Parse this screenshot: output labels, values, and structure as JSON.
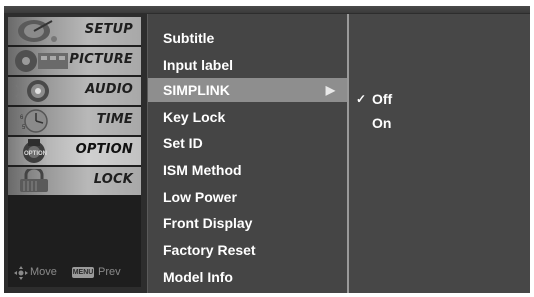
{
  "tabs": [
    {
      "label": "SETUP",
      "icon": "satellite-dish-icon",
      "active": false
    },
    {
      "label": "PICTURE",
      "icon": "film-reel-icon",
      "active": false
    },
    {
      "label": "AUDIO",
      "icon": "speaker-icon",
      "active": false
    },
    {
      "label": "TIME",
      "icon": "clock-icon",
      "active": false
    },
    {
      "label": "OPTION",
      "icon": "option-disc-icon",
      "active": true
    },
    {
      "label": "LOCK",
      "icon": "lock-icon",
      "active": false
    }
  ],
  "footer": {
    "move_icon": "directional-pad-icon",
    "move_label": "Move",
    "menu_key": "MENU",
    "prev_label": "Prev"
  },
  "menu": {
    "items": [
      {
        "label": "Subtitle"
      },
      {
        "label": "Input label"
      },
      {
        "label": "SIMPLINK",
        "selected": true,
        "has_submenu": true
      },
      {
        "label": "Key Lock"
      },
      {
        "label": "Set ID"
      },
      {
        "label": "ISM Method"
      },
      {
        "label": "Low Power"
      },
      {
        "label": "Front Display"
      },
      {
        "label": "Factory Reset"
      },
      {
        "label": "Model Info"
      }
    ],
    "arrow_glyph": "▶"
  },
  "submenu": {
    "items": [
      {
        "label": "Off",
        "checked": true
      },
      {
        "label": "On",
        "checked": false
      }
    ],
    "check_glyph": "✓"
  },
  "colors": {
    "selected_row": "#8e8e8e",
    "panel": "#454545",
    "text": "#ffffff"
  }
}
